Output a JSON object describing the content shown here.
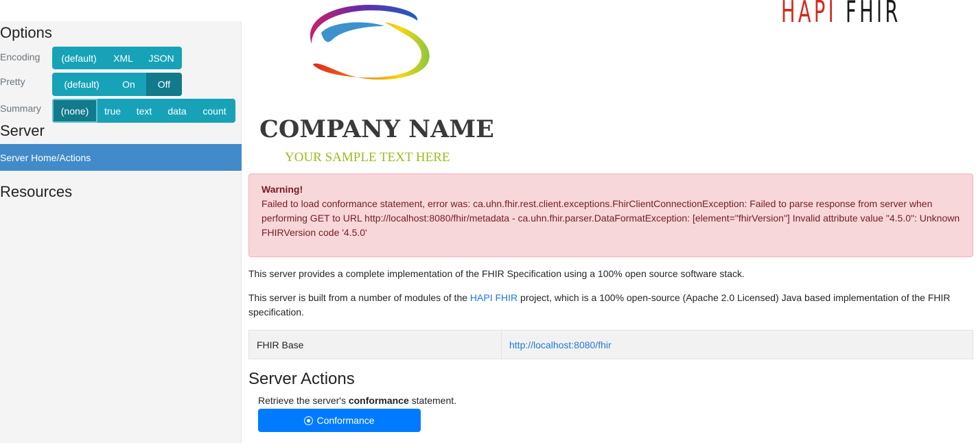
{
  "brand": {
    "company_name": "COMPANY NAME",
    "tagline": "YOUR SAMPLE TEXT HERE",
    "hapi_part1": "HAPI",
    "hapi_part2": "FHIR",
    "colors": {
      "hapi_red": "#d3291c",
      "tagline_green": "#9cbb1c"
    }
  },
  "sidebar": {
    "options_heading": "Options",
    "encoding": {
      "label": "Encoding",
      "choices": [
        "(default)",
        "XML",
        "JSON"
      ],
      "selected": "(default)"
    },
    "pretty": {
      "label": "Pretty",
      "choices": [
        "(default)",
        "On",
        "Off"
      ],
      "selected": "Off"
    },
    "summary": {
      "label": "Summary",
      "choices": [
        "(none)",
        "true",
        "text",
        "data",
        "count"
      ],
      "selected": "(none)"
    },
    "server_heading": "Server",
    "server_home_label": "Server Home/Actions",
    "resources_heading": "Resources"
  },
  "alert": {
    "title": "Warning!",
    "message": "Failed to load conformance statement, error was: ca.uhn.fhir.rest.client.exceptions.FhirClientConnectionException: Failed to parse response from server when performing GET to URL http://localhost:8080/fhir/metadata - ca.uhn.fhir.parser.DataFormatException: [element=\"fhirVersion\"] Invalid attribute value \"4.5.0\": Unknown FHIRVersion code '4.5.0'"
  },
  "intro": {
    "line1": "This server provides a complete implementation of the FHIR Specification using a 100% open source software stack.",
    "line2_before": "This server is built from a number of modules of the ",
    "line2_link": "HAPI FHIR",
    "line2_after": " project, which is a 100% open-source (Apache 2.0 Licensed) Java based implementation of the FHIR specification."
  },
  "info_table": {
    "label": "FHIR Base",
    "value": "http://localhost:8080/fhir"
  },
  "server_actions": {
    "heading": "Server Actions",
    "desc_before": "Retrieve the server's ",
    "desc_bold": "conformance",
    "desc_after": " statement.",
    "button_label": "Conformance"
  }
}
